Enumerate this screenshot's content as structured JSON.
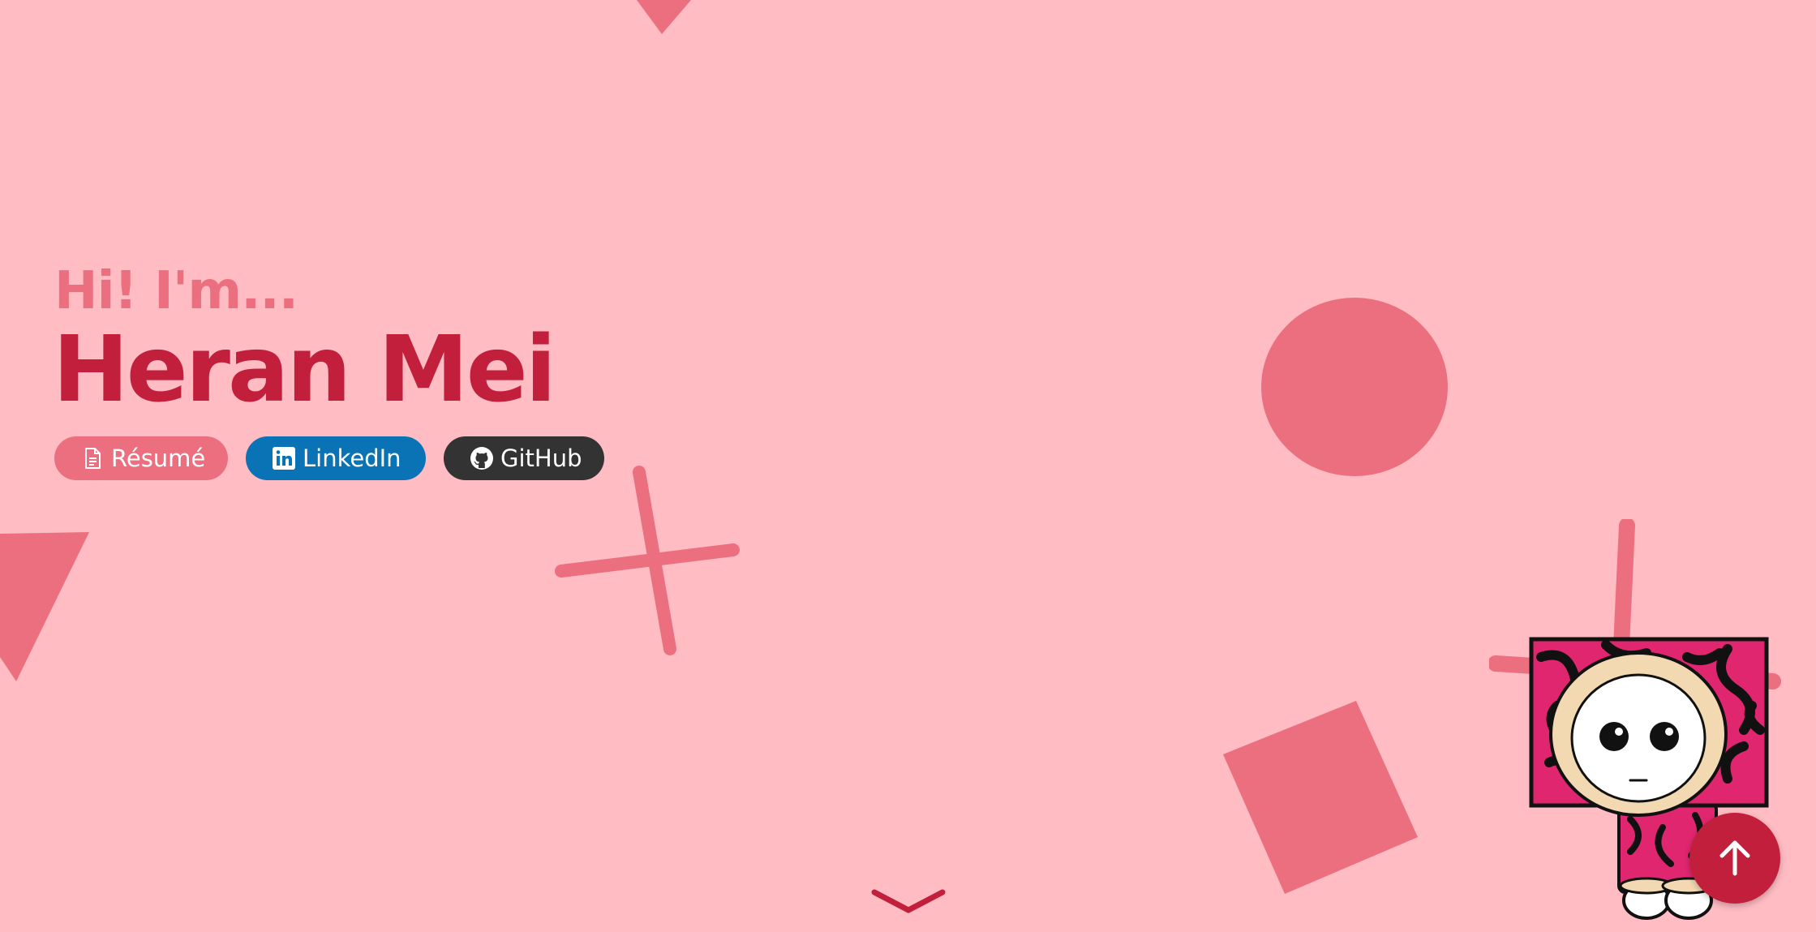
{
  "hero": {
    "greeting": "Hi! I'm...",
    "name": "Heran Mei"
  },
  "links": {
    "resume": {
      "label": "Résumé",
      "icon": "document-icon"
    },
    "linkedin": {
      "label": "LinkedIn",
      "icon": "linkedin-icon"
    },
    "github": {
      "label": "GitHub",
      "icon": "github-icon"
    }
  },
  "colors": {
    "background": "#ffbcc3",
    "accent": "#ec6f7f",
    "primary": "#c21f3c",
    "linkedin": "#0a73b5",
    "github": "#333333"
  },
  "controls": {
    "scroll_down_icon": "chevron-down-icon",
    "back_to_top_icon": "arrow-up-icon"
  }
}
